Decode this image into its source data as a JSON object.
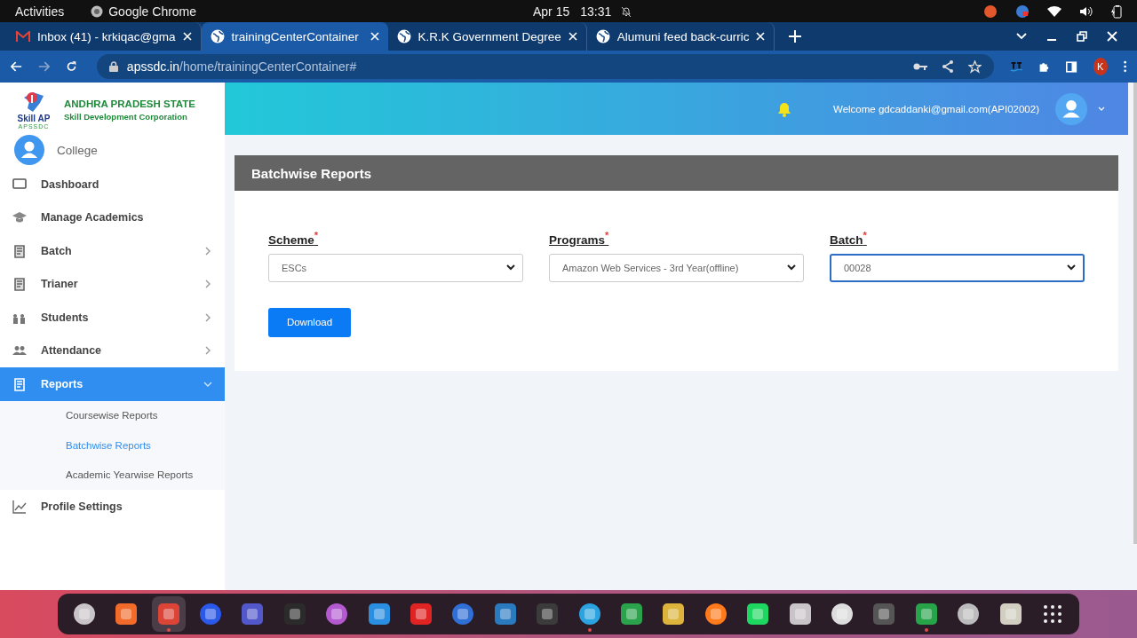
{
  "system_bar": {
    "activities": "Activities",
    "app_name": "Google Chrome",
    "date": "Apr 15",
    "time": "13:31"
  },
  "browser": {
    "tabs": [
      {
        "title": "Inbox (41) - krkiqac@gma",
        "kind": "mail",
        "selected": false
      },
      {
        "title": "trainingCenterContainer",
        "kind": "globe",
        "selected": true
      },
      {
        "title": "K.R.K Government Degree",
        "kind": "globe",
        "selected": false
      },
      {
        "title": "Alumuni feed back-curric",
        "kind": "globe",
        "selected": false
      }
    ],
    "address": {
      "domain": "apssdc.in",
      "path": "/home/trainingCenterContainer#"
    },
    "profile_initial": "K"
  },
  "brand": {
    "logo_text": "Skill AP",
    "logo_sub": "APSSDC",
    "title": "ANDHRA PRADESH STATE",
    "subtitle": "Skill Development Corporation"
  },
  "user_role": "College",
  "header": {
    "welcome": "Welcome gdcaddanki@gmail.com(API02002)"
  },
  "sidebar": {
    "items": [
      {
        "label": "Dashboard",
        "expandable": false,
        "selected": false
      },
      {
        "label": "Manage Academics",
        "expandable": false,
        "selected": false
      },
      {
        "label": "Batch",
        "expandable": true,
        "expanded": false,
        "selected": false
      },
      {
        "label": "Trianer",
        "expandable": true,
        "expanded": false,
        "selected": false
      },
      {
        "label": "Students",
        "expandable": true,
        "expanded": false,
        "selected": false
      },
      {
        "label": "Attendance",
        "expandable": true,
        "expanded": false,
        "selected": false
      },
      {
        "label": "Reports",
        "expandable": true,
        "expanded": true,
        "selected": true,
        "children": [
          {
            "label": "Coursewise Reports",
            "selected": false
          },
          {
            "label": "Batchwise Reports",
            "selected": true
          },
          {
            "label": "Academic Yearwise Reports",
            "selected": false
          }
        ]
      },
      {
        "label": "Profile Settings",
        "expandable": false,
        "selected": false
      }
    ]
  },
  "panel": {
    "title": "Batchwise Reports",
    "fields": [
      {
        "label": "Scheme",
        "required_mark": "*",
        "value": "ESCs",
        "focused": false
      },
      {
        "label": "Programs",
        "required_mark": "*",
        "value": "Amazon Web Services - 3rd Year(offline)",
        "focused": false
      },
      {
        "label": "Batch",
        "required_mark": "*",
        "value": "00028",
        "focused": true
      }
    ],
    "button": "Download"
  },
  "dock": [
    {
      "running": false
    },
    {
      "running": false
    },
    {
      "running": true
    },
    {
      "running": false
    },
    {
      "running": false
    },
    {
      "running": false
    },
    {
      "running": false
    },
    {
      "running": false
    },
    {
      "running": false
    },
    {
      "running": false
    },
    {
      "running": false
    },
    {
      "running": false
    },
    {
      "running": true
    },
    {
      "running": false
    },
    {
      "running": false
    },
    {
      "running": false
    },
    {
      "running": false
    },
    {
      "running": false
    },
    {
      "running": false
    },
    {
      "running": false
    },
    {
      "running": true
    },
    {
      "running": false
    },
    {
      "running": false
    },
    {
      "running": false
    }
  ]
}
